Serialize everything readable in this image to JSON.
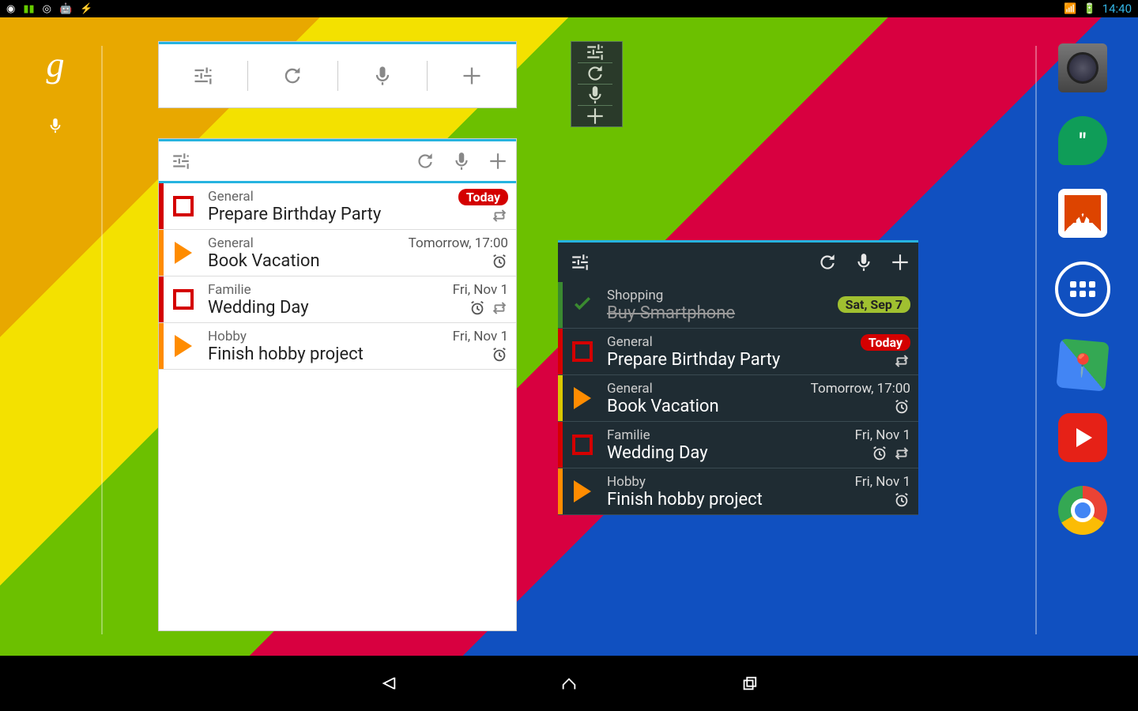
{
  "status": {
    "time": "14:40"
  },
  "icons": {
    "sliders": "sliders-icon",
    "refresh": "refresh-icon",
    "mic": "mic-icon",
    "plus": "plus-icon"
  },
  "widget_light": {
    "tasks": [
      {
        "color": "#d40000",
        "marker": "checkbox",
        "category": "General",
        "title": "Prepare Birthday Party",
        "badge": {
          "text": "Today",
          "style": "red"
        },
        "due": "",
        "alarm": false,
        "repeat": true
      },
      {
        "color": "#ff8c00",
        "marker": "play",
        "category": "General",
        "title": "Book Vacation",
        "badge": null,
        "due": "Tomorrow, 17:00",
        "alarm": true,
        "repeat": false
      },
      {
        "color": "#d40000",
        "marker": "checkbox",
        "category": "Familie",
        "title": "Wedding Day",
        "badge": null,
        "due": "Fri, Nov 1",
        "alarm": true,
        "repeat": true
      },
      {
        "color": "#ff8c00",
        "marker": "play",
        "category": "Hobby",
        "title": "Finish hobby project",
        "badge": null,
        "due": "Fri, Nov 1",
        "alarm": true,
        "repeat": false
      }
    ]
  },
  "widget_dark": {
    "tasks": [
      {
        "color": "#3a8a30",
        "marker": "done",
        "category": "Shopping",
        "title": "Buy Smartphone",
        "badge": {
          "text": "Sat, Sep 7",
          "style": "green"
        },
        "due": "",
        "alarm": false,
        "repeat": false,
        "completed": true
      },
      {
        "color": "#d40000",
        "marker": "checkbox",
        "category": "General",
        "title": "Prepare Birthday Party",
        "badge": {
          "text": "Today",
          "style": "red"
        },
        "due": "",
        "alarm": false,
        "repeat": true
      },
      {
        "color": "#d8c800",
        "marker": "play",
        "category": "General",
        "title": "Book Vacation",
        "badge": null,
        "due": "Tomorrow, 17:00",
        "alarm": true,
        "repeat": false
      },
      {
        "color": "#d40000",
        "marker": "checkbox",
        "category": "Familie",
        "title": "Wedding Day",
        "badge": null,
        "due": "Fri, Nov 1",
        "alarm": true,
        "repeat": true
      },
      {
        "color": "#ff8c00",
        "marker": "play",
        "category": "Hobby",
        "title": "Finish hobby project",
        "badge": null,
        "due": "Fri, Nov 1",
        "alarm": true,
        "repeat": false
      }
    ]
  },
  "dock": [
    "camera",
    "hangouts",
    "gmail",
    "apps",
    "maps",
    "youtube",
    "chrome"
  ]
}
